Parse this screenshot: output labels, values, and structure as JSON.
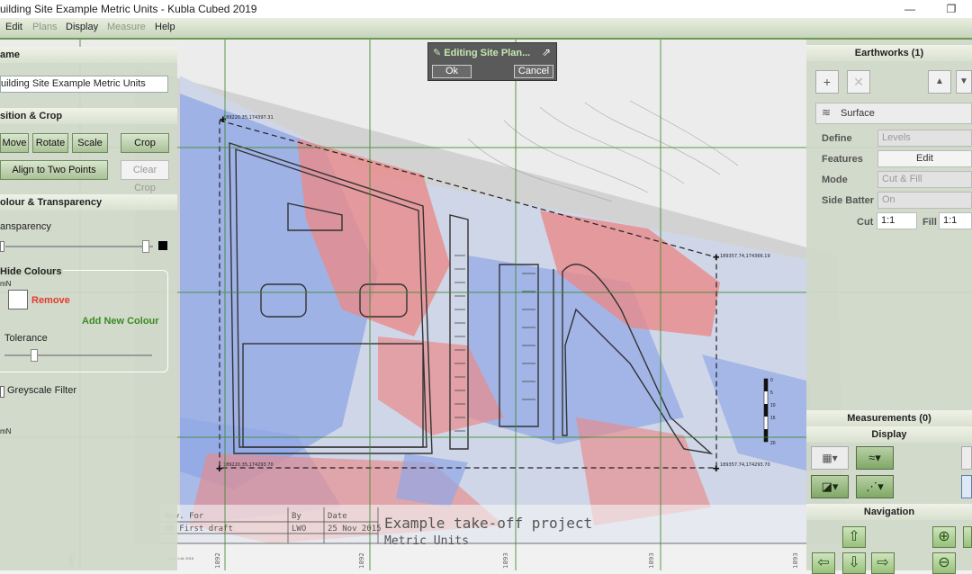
{
  "window": {
    "title": "uilding Site Example Metric Units - Kubla Cubed 2019",
    "minimize_glyph": "—",
    "restore_glyph": "❐"
  },
  "menu": {
    "items": [
      {
        "label": "Edit",
        "enabled": true
      },
      {
        "label": "Plans",
        "enabled": false
      },
      {
        "label": "Display",
        "enabled": true
      },
      {
        "label": "Measure",
        "enabled": false
      },
      {
        "label": "Help",
        "enabled": true
      }
    ]
  },
  "left_panel": {
    "name_header": "ame",
    "name_value": "uilding Site Example Metric Units",
    "position_header": "sition & Crop",
    "move": "Move",
    "rotate": "Rotate",
    "scale": "Scale",
    "crop": "Crop",
    "align": "Align to Two Points",
    "clear_crop": "Clear Crop",
    "colour_header": "olour & Transparency",
    "transparency_label": "ansparency",
    "hide_colours_label": "Hide Colours",
    "swatch_caption": "mN",
    "remove": "Remove",
    "add_new_colour": "Add New Colour",
    "tolerance_label": "Tolerance",
    "greyscale_label": "Greyscale Filter",
    "bottom_caption": "mN",
    "transparency_level": 0.95,
    "tolerance_level": 0.2
  },
  "popup": {
    "title": "Editing Site Plan...",
    "ok": "Ok",
    "cancel": "Cancel"
  },
  "right_panel": {
    "earthworks_header": "Earthworks (1)",
    "surface_label": "Surface",
    "define_label": "Define",
    "define_value": "Levels",
    "features_label": "Features",
    "features_button": "Edit",
    "mode_label": "Mode",
    "mode_value": "Cut & Fill",
    "side_batter_label": "Side Batter",
    "side_batter_value": "On",
    "cut_label": "Cut",
    "cut_value": "1:1",
    "fill_label": "Fill",
    "fill_value": "1:1",
    "measurements_header": "Measurements (0)",
    "display_header": "Display",
    "navigation_header": "Navigation"
  },
  "drawing": {
    "corner_tl": "189220.35,174397.31",
    "corner_tr": "189357.74,174366.19",
    "corner_bl": "189220.35,174293.70",
    "corner_br": "189357.74,174293.70",
    "rev_label": "Rev. For",
    "rev_value": "00  First draft",
    "by_label": "By",
    "by_value": "LWO",
    "date_label": "Date",
    "date_value": "25 Nov 2015",
    "project_title": "Example take-off project",
    "project_subtitle": "Metric Units",
    "copyright": "© Kubla Ltd. 2015",
    "scale_labels": [
      "0",
      "5",
      "10",
      "15",
      "20"
    ],
    "bottom_ticks": [
      "1892",
      "1892",
      "1892",
      "1893",
      "1893",
      "1893"
    ]
  },
  "colors": {
    "cut": "#e88a8a",
    "fill": "#8fa6e6",
    "grid": "#3c8a2c",
    "accent": "#6f9a55"
  }
}
